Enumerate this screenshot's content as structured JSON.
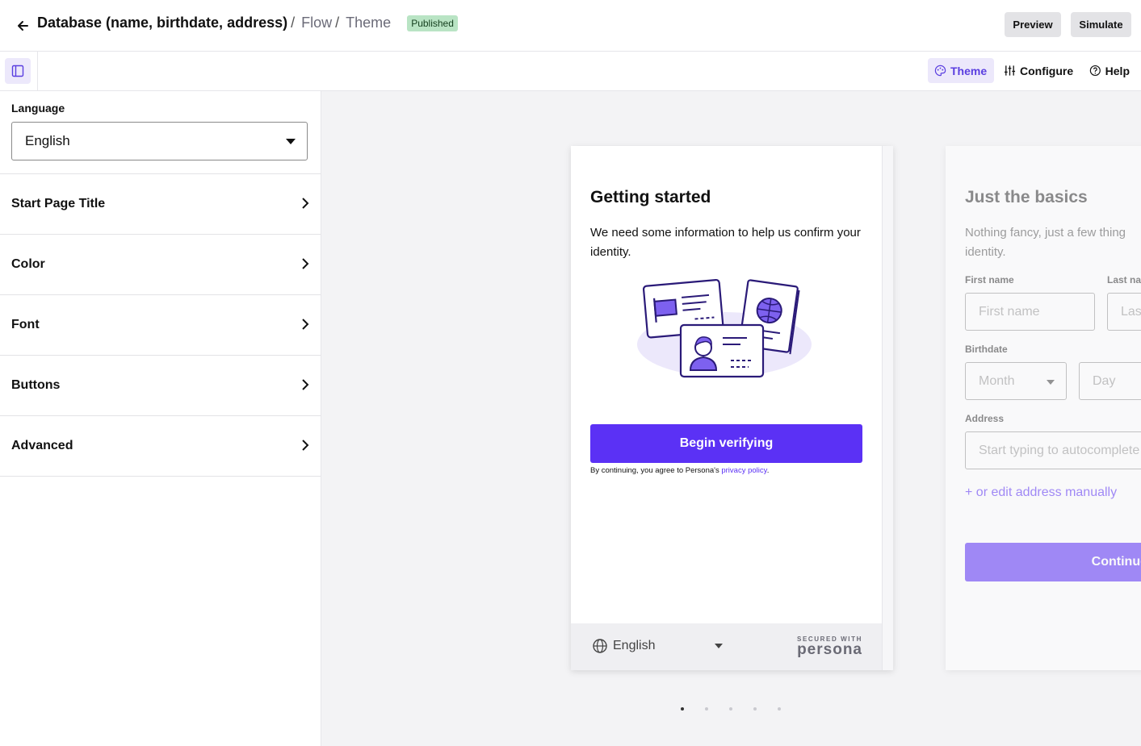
{
  "header": {
    "back_icon": "arrow-left-icon",
    "crumb_root": "Database (name, birthdate, address)",
    "crumb_sep": "/",
    "crumb_flow": "Flow",
    "crumb_theme": "Theme",
    "status_badge": "Published",
    "preview_label": "Preview",
    "simulate_label": "Simulate"
  },
  "subbar": {
    "panel_toggle_icon": "sidebar-panel-icon",
    "tabs": [
      {
        "label": "Theme",
        "icon": "palette-icon",
        "active": true
      },
      {
        "label": "Configure",
        "icon": "sliders-icon",
        "active": false
      },
      {
        "label": "Help",
        "icon": "help-circle-icon",
        "active": false
      }
    ]
  },
  "sidebar": {
    "language_label": "Language",
    "language_value": "English",
    "sections": [
      "Start Page Title",
      "Color",
      "Font",
      "Buttons",
      "Advanced"
    ]
  },
  "preview": {
    "card1": {
      "title": "Getting started",
      "subtitle": "We need some information to help us confirm your identity.",
      "begin_button": "Begin verifying",
      "legal_prefix": "By continuing, you agree to Persona's ",
      "legal_link": "privacy policy",
      "legal_suffix": ".",
      "footer_language": "English",
      "secured_with": "SECURED WITH",
      "brand": "persona"
    },
    "card2": {
      "title": "Just the basics",
      "subtitle_line1": "Nothing fancy, just a few thing",
      "subtitle_line2": "identity.",
      "first_name_label": "First name",
      "first_name_placeholder": "First name",
      "last_name_label": "Last na",
      "last_name_placeholder": "Las",
      "birthdate_label": "Birthdate",
      "month_placeholder": "Month",
      "day_placeholder": "Day",
      "address_label": "Address",
      "address_placeholder": "Start typing to autocomplete",
      "manual_link": "+ or edit address manually",
      "continue_button": "Continue"
    },
    "pager": {
      "count": 5,
      "active_index": 0
    }
  },
  "colors": {
    "accent": "#5b31f5",
    "badge_bg": "#b9e4c4",
    "canvas_bg": "#f3f3f5"
  }
}
